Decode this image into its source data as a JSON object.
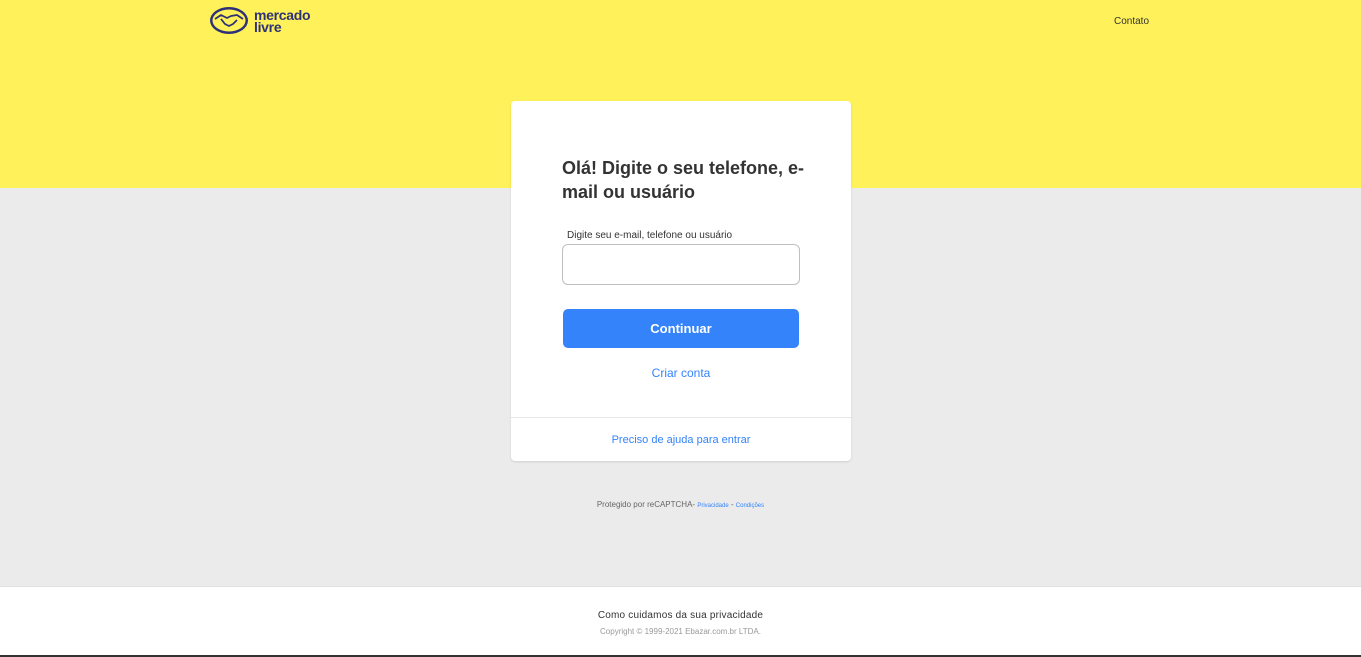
{
  "header": {
    "logo_line1": "mercado",
    "logo_line2": "livre",
    "contact_label": "Contato"
  },
  "login": {
    "title": "Olá! Digite o seu telefone, e-mail ou usuário",
    "input_label": "Digite seu e-mail, telefone ou usuário",
    "input_value": "",
    "continue_label": "Continuar",
    "create_account_label": "Criar conta",
    "help_label": "Preciso de ajuda para entrar"
  },
  "recaptcha": {
    "text": "Protegido por reCAPTCHA-",
    "privacy_label": "Privacidade",
    "separator": " - ",
    "terms_label": "Condições"
  },
  "footer": {
    "privacy_label": "Como cuidamos da sua privacidade",
    "copyright": "Copyright © 1999-2021 Ebazar.com.br LTDA."
  },
  "colors": {
    "brand_yellow": "#fff159",
    "accent_blue": "#3483fa",
    "logo_navy": "#2d3277",
    "background_gray": "#ebebeb"
  }
}
